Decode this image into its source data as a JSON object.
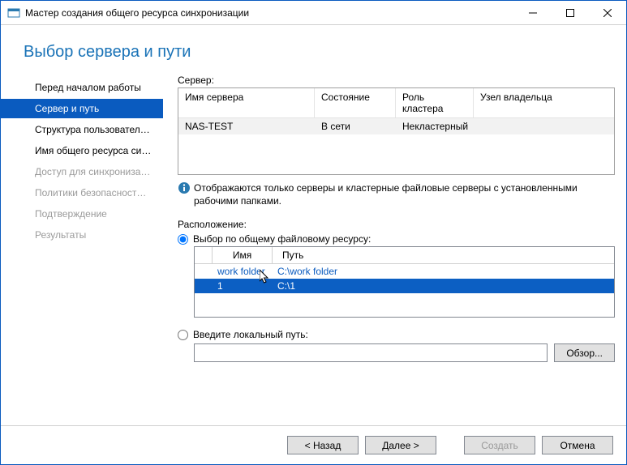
{
  "window": {
    "title": "Мастер создания общего ресурса синхронизации"
  },
  "page_title": "Выбор сервера и пути",
  "sidebar": {
    "items": [
      {
        "label": "Перед началом работы",
        "state": "normal"
      },
      {
        "label": "Сервер и путь",
        "state": "active"
      },
      {
        "label": "Структура пользовател…",
        "state": "normal"
      },
      {
        "label": "Имя общего ресурса си…",
        "state": "normal"
      },
      {
        "label": "Доступ для синхрониза…",
        "state": "disabled"
      },
      {
        "label": "Политики безопасност…",
        "state": "disabled"
      },
      {
        "label": "Подтверждение",
        "state": "disabled"
      },
      {
        "label": "Результаты",
        "state": "disabled"
      }
    ]
  },
  "server": {
    "label": "Сервер:",
    "columns": {
      "name": "Имя сервера",
      "state": "Состояние",
      "role": "Роль кластера",
      "owner": "Узел владельца"
    },
    "rows": [
      {
        "name": "NAS-TEST",
        "state": "В сети",
        "role": "Некластерный",
        "owner": ""
      }
    ]
  },
  "info": "Отображаются только серверы и кластерные файловые серверы с установленными рабочими папками.",
  "location": {
    "label": "Расположение:",
    "option_share": "Выбор по общему файловому ресурсу:",
    "option_local": "Введите локальный путь:",
    "share_table": {
      "columns": {
        "name": "Имя",
        "path": "Путь"
      },
      "rows": [
        {
          "name": "work folder",
          "path": "C:\\work folder",
          "selected": false
        },
        {
          "name": "1",
          "path": "C:\\1",
          "selected": true
        }
      ]
    },
    "local_value": "",
    "browse": "Обзор..."
  },
  "buttons": {
    "back": "< Назад",
    "next": "Далее >",
    "create": "Создать",
    "cancel": "Отмена"
  }
}
